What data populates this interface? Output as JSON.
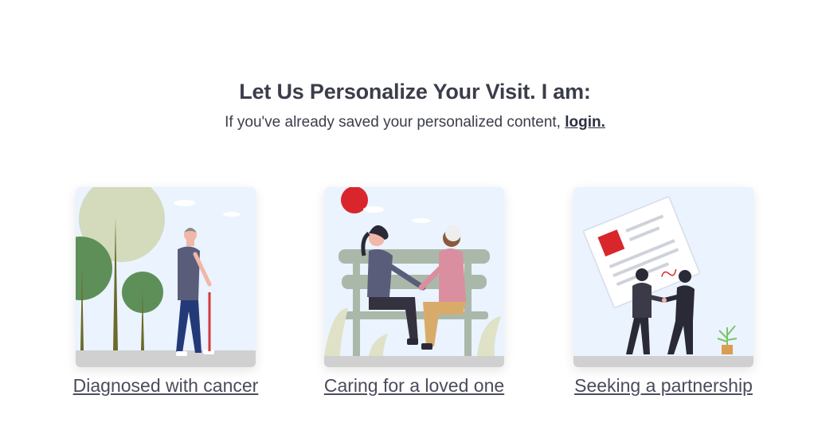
{
  "heading": "Let Us Personalize Your Visit. I am:",
  "subheading": {
    "text": "If you've already saved your personalized content,",
    "link": "login."
  },
  "cards": [
    {
      "label": "Diagnosed with cancer"
    },
    {
      "label": "Caring for a loved one"
    },
    {
      "label": "Seeking a partnership"
    }
  ]
}
